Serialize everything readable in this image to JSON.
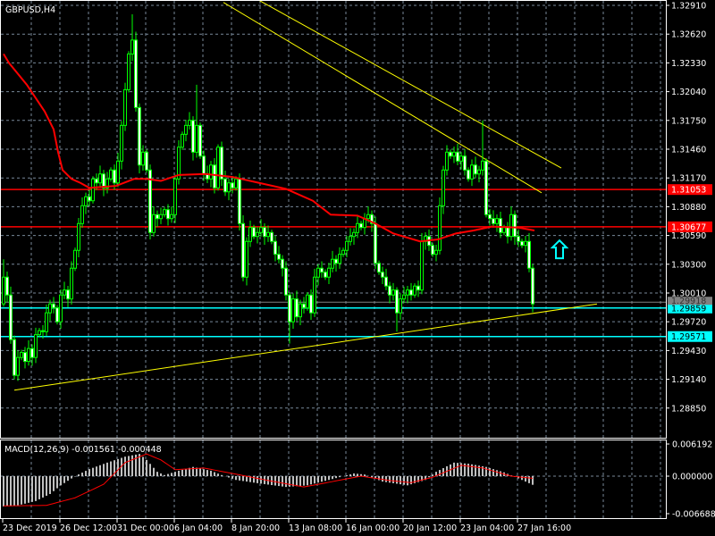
{
  "window": {
    "symbol_title": "GBPUSD,H4"
  },
  "macd_label": "MACD(12,26,9) -0.001561 -0.000448",
  "colors": {
    "background": "#000000",
    "candle": "#00ff00",
    "bear_fill": "#ffffff",
    "ma": "#ff0000",
    "trendline": "#ffff00",
    "support_level": "#00ffff",
    "resistance_level": "#ff0000",
    "grid": "#778899",
    "bid": "#808080"
  },
  "price_axis": {
    "ticks": [
      "1.32910",
      "1.32620",
      "1.32330",
      "1.32040",
      "1.31750",
      "1.31460",
      "1.31170",
      "1.30880",
      "1.30590",
      "1.30300",
      "1.30010",
      "1.29720",
      "1.29430",
      "1.29140",
      "1.28850"
    ]
  },
  "macd_axis": {
    "ticks": [
      "0.006192",
      "0.000000",
      "-0.006688"
    ]
  },
  "time_axis": {
    "labels": [
      "23 Dec 2019",
      "26 Dec 12:00",
      "31 Dec 00:00",
      "6 Jan 04:00",
      "8 Jan 20:00",
      "13 Jan 08:00",
      "16 Jan 00:00",
      "20 Jan 12:00",
      "23 Jan 04:00",
      "27 Jan 16:00"
    ]
  },
  "levels": [
    {
      "price": 1.31053,
      "label": "1.31053",
      "kind": "resistance"
    },
    {
      "price": 1.30677,
      "label": "1.30677",
      "kind": "resistance"
    },
    {
      "price": 1.29859,
      "label": "1.29859",
      "kind": "support"
    },
    {
      "price": 1.29571,
      "label": "1.29571",
      "kind": "support"
    }
  ],
  "bid": {
    "price": 1.29918,
    "label": "1.29918"
  },
  "arrow": {
    "icon": "up-arrow-icon",
    "bar": 154,
    "price": 1.3045
  },
  "chart_data": {
    "type": "candlestick",
    "symbol": "GBPUSD",
    "timeframe": "H4",
    "first_open": 1.299,
    "closes": [
      1.3017,
      1.2999,
      1.2954,
      1.2918,
      1.2936,
      1.2941,
      1.2932,
      1.2945,
      1.2936,
      1.2959,
      1.2963,
      1.2962,
      1.2981,
      1.299,
      1.2986,
      1.2972,
      1.2999,
      1.3004,
      1.2995,
      1.3026,
      1.3044,
      1.3071,
      1.3089,
      1.3098,
      1.3094,
      1.3116,
      1.3112,
      1.3121,
      1.3107,
      1.3116,
      1.3125,
      1.3112,
      1.3134,
      1.317,
      1.3206,
      1.3242,
      1.3256,
      1.3188,
      1.313,
      1.3143,
      1.3125,
      1.3062,
      1.308,
      1.3076,
      1.308,
      1.3085,
      1.3076,
      1.308,
      1.3116,
      1.3148,
      1.3161,
      1.317,
      1.3175,
      1.3143,
      1.317,
      1.3139,
      1.3121,
      1.3116,
      1.313,
      1.3107,
      1.3148,
      1.3116,
      1.3103,
      1.3112,
      1.3107,
      1.3116,
      1.3071,
      1.3017,
      1.3053,
      1.3067,
      1.3058,
      1.3062,
      1.3067,
      1.3058,
      1.3062,
      1.3053,
      1.304,
      1.3035,
      1.3026,
      1.2999,
      1.2972,
      1.2995,
      1.2977,
      1.299,
      1.2986,
      1.2999,
      1.2981,
      1.3017,
      1.3026,
      1.3022,
      1.3017,
      1.3026,
      1.3035,
      1.3031,
      1.304,
      1.3044,
      1.3053,
      1.3058,
      1.3062,
      1.3071,
      1.3067,
      1.3076,
      1.308,
      1.3071,
      1.3031,
      1.3022,
      1.3017,
      1.3008,
      1.2999,
      1.3004,
      1.2981,
      1.2995,
      1.2999,
      1.3004,
      1.2999,
      1.3008,
      1.3004,
      1.3053,
      1.3058,
      1.3049,
      1.304,
      1.3044,
      1.3089,
      1.3125,
      1.3143,
      1.3139,
      1.3143,
      1.3134,
      1.3139,
      1.3125,
      1.3116,
      1.313,
      1.3121,
      1.3125,
      1.3134,
      1.308,
      1.3076,
      1.3071,
      1.3076,
      1.3062,
      1.3067,
      1.3058,
      1.308,
      1.3058,
      1.3053,
      1.3049,
      1.3053,
      1.3026,
      1.299
    ],
    "wick": 0.0007,
    "extreme_highs": {
      "36": 1.3282,
      "54": 1.3211,
      "134": 1.3175,
      "0": 1.3035
    },
    "extreme_lows": {
      "3": 1.2914,
      "80": 1.295,
      "110": 1.2962
    },
    "ma_anchors": [
      [
        0,
        1.3242
      ],
      [
        1.5,
        1.3233
      ],
      [
        6.5,
        1.3211
      ],
      [
        11.5,
        1.3184
      ],
      [
        14,
        1.3166
      ],
      [
        15.25,
        1.3143
      ],
      [
        16.5,
        1.3125
      ],
      [
        19,
        1.3116
      ],
      [
        21.5,
        1.3112
      ],
      [
        24,
        1.3107
      ],
      [
        31.5,
        1.3109
      ],
      [
        36.5,
        1.3116
      ],
      [
        40,
        1.3116
      ],
      [
        44,
        1.3114
      ],
      [
        49,
        1.312
      ],
      [
        56.5,
        1.3121
      ],
      [
        64,
        1.3118
      ],
      [
        71.5,
        1.3112
      ],
      [
        79,
        1.3106
      ],
      [
        86.5,
        1.3094
      ],
      [
        91.5,
        1.308
      ],
      [
        99,
        1.3079
      ],
      [
        104,
        1.3071
      ],
      [
        109,
        1.3061
      ],
      [
        116.5,
        1.3053
      ],
      [
        121.5,
        1.3055
      ],
      [
        126.5,
        1.3061
      ],
      [
        131.5,
        1.3064
      ],
      [
        136.5,
        1.3068
      ],
      [
        144,
        1.3067
      ],
      [
        148.5,
        1.3064
      ]
    ],
    "trendlines": [
      {
        "from": [
          61.5,
          1.3294
        ],
        "to": [
          150.5,
          1.3102
        ]
      },
      {
        "from": [
          71.5,
          1.3296
        ],
        "to": [
          156,
          1.3127
        ]
      },
      {
        "from": [
          3,
          1.2903
        ],
        "to": [
          166,
          1.299
        ]
      }
    ],
    "price_range": [
      1.285,
      1.3291
    ],
    "macd": {
      "params": "12,26,9",
      "range": [
        -0.006688,
        0.006192
      ],
      "hist_anchors": [
        [
          0,
          -0.0056
        ],
        [
          4,
          -0.0054
        ],
        [
          9,
          -0.0046
        ],
        [
          13,
          -0.0033
        ],
        [
          16,
          -0.0017
        ],
        [
          20,
          0.0
        ],
        [
          24,
          0.0013
        ],
        [
          29,
          0.0025
        ],
        [
          34,
          0.0036
        ],
        [
          38,
          0.0041
        ],
        [
          40,
          0.003
        ],
        [
          43,
          0.0008
        ],
        [
          45,
          0.0002
        ],
        [
          49,
          0.001
        ],
        [
          53,
          0.0017
        ],
        [
          58,
          0.001
        ],
        [
          61,
          0.0002
        ],
        [
          65,
          -0.0007
        ],
        [
          71,
          -0.0013
        ],
        [
          79,
          -0.002
        ],
        [
          85,
          -0.0017
        ],
        [
          91,
          -0.0007
        ],
        [
          98,
          0.0005
        ],
        [
          101,
          0.0003
        ],
        [
          106,
          -0.001
        ],
        [
          113,
          -0.0017
        ],
        [
          118,
          -0.0007
        ],
        [
          121,
          0.0008
        ],
        [
          126,
          0.0025
        ],
        [
          130,
          0.0023
        ],
        [
          135,
          0.0017
        ],
        [
          140,
          0.0007
        ],
        [
          145,
          -0.0007
        ],
        [
          148,
          -0.0016
        ]
      ],
      "signal_anchors": [
        [
          0,
          -0.0055
        ],
        [
          12,
          -0.0054
        ],
        [
          20,
          -0.004
        ],
        [
          28,
          -0.0015
        ],
        [
          34,
          0.0025
        ],
        [
          40,
          0.0041
        ],
        [
          44,
          0.003
        ],
        [
          48,
          0.0012
        ],
        [
          56,
          0.0015
        ],
        [
          64,
          0.0005
        ],
        [
          74,
          -0.0008
        ],
        [
          84,
          -0.002
        ],
        [
          92,
          -0.001
        ],
        [
          100,
          0.0
        ],
        [
          108,
          -0.0008
        ],
        [
          114,
          -0.0012
        ],
        [
          120,
          -0.0002
        ],
        [
          128,
          0.002
        ],
        [
          134,
          0.0015
        ],
        [
          142,
          0.0
        ],
        [
          148,
          -0.0004
        ]
      ]
    }
  }
}
